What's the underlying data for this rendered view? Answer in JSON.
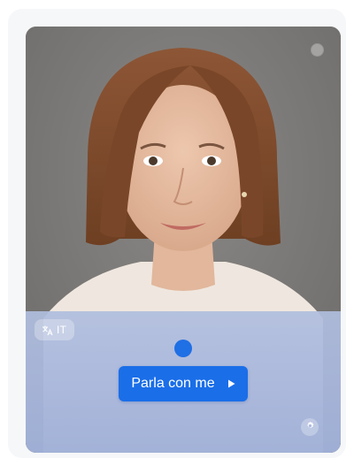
{
  "avatar": {
    "description_icon": "portrait-image"
  },
  "language": {
    "code": "IT",
    "icon": "translate-icon"
  },
  "controls": {
    "talk_label": "Parla con me",
    "talk_icon": "play-icon",
    "settings_icon": "gear-icon",
    "status_icon": "status-dot"
  },
  "colors": {
    "accent": "#1a6ee8",
    "overlay": "#aebbe0"
  }
}
